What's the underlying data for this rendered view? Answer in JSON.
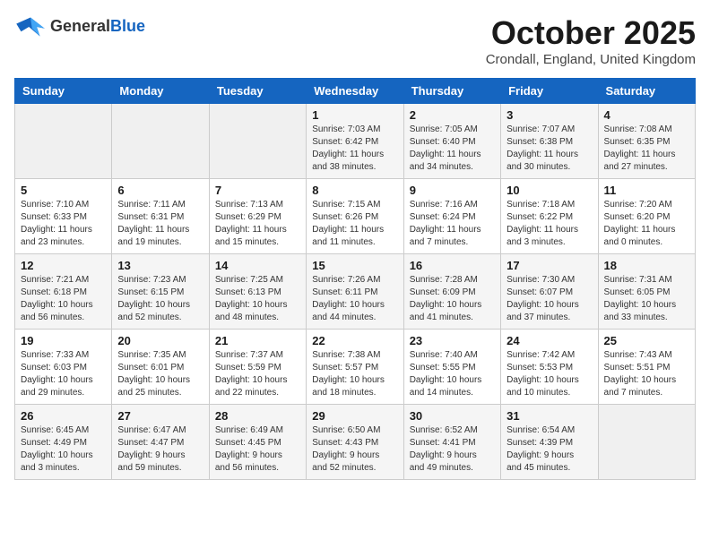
{
  "header": {
    "logo_general": "General",
    "logo_blue": "Blue",
    "month_title": "October 2025",
    "location": "Crondall, England, United Kingdom"
  },
  "weekdays": [
    "Sunday",
    "Monday",
    "Tuesday",
    "Wednesday",
    "Thursday",
    "Friday",
    "Saturday"
  ],
  "weeks": [
    [
      {
        "day": "",
        "info": ""
      },
      {
        "day": "",
        "info": ""
      },
      {
        "day": "",
        "info": ""
      },
      {
        "day": "1",
        "info": "Sunrise: 7:03 AM\nSunset: 6:42 PM\nDaylight: 11 hours\nand 38 minutes."
      },
      {
        "day": "2",
        "info": "Sunrise: 7:05 AM\nSunset: 6:40 PM\nDaylight: 11 hours\nand 34 minutes."
      },
      {
        "day": "3",
        "info": "Sunrise: 7:07 AM\nSunset: 6:38 PM\nDaylight: 11 hours\nand 30 minutes."
      },
      {
        "day": "4",
        "info": "Sunrise: 7:08 AM\nSunset: 6:35 PM\nDaylight: 11 hours\nand 27 minutes."
      }
    ],
    [
      {
        "day": "5",
        "info": "Sunrise: 7:10 AM\nSunset: 6:33 PM\nDaylight: 11 hours\nand 23 minutes."
      },
      {
        "day": "6",
        "info": "Sunrise: 7:11 AM\nSunset: 6:31 PM\nDaylight: 11 hours\nand 19 minutes."
      },
      {
        "day": "7",
        "info": "Sunrise: 7:13 AM\nSunset: 6:29 PM\nDaylight: 11 hours\nand 15 minutes."
      },
      {
        "day": "8",
        "info": "Sunrise: 7:15 AM\nSunset: 6:26 PM\nDaylight: 11 hours\nand 11 minutes."
      },
      {
        "day": "9",
        "info": "Sunrise: 7:16 AM\nSunset: 6:24 PM\nDaylight: 11 hours\nand 7 minutes."
      },
      {
        "day": "10",
        "info": "Sunrise: 7:18 AM\nSunset: 6:22 PM\nDaylight: 11 hours\nand 3 minutes."
      },
      {
        "day": "11",
        "info": "Sunrise: 7:20 AM\nSunset: 6:20 PM\nDaylight: 11 hours\nand 0 minutes."
      }
    ],
    [
      {
        "day": "12",
        "info": "Sunrise: 7:21 AM\nSunset: 6:18 PM\nDaylight: 10 hours\nand 56 minutes."
      },
      {
        "day": "13",
        "info": "Sunrise: 7:23 AM\nSunset: 6:15 PM\nDaylight: 10 hours\nand 52 minutes."
      },
      {
        "day": "14",
        "info": "Sunrise: 7:25 AM\nSunset: 6:13 PM\nDaylight: 10 hours\nand 48 minutes."
      },
      {
        "day": "15",
        "info": "Sunrise: 7:26 AM\nSunset: 6:11 PM\nDaylight: 10 hours\nand 44 minutes."
      },
      {
        "day": "16",
        "info": "Sunrise: 7:28 AM\nSunset: 6:09 PM\nDaylight: 10 hours\nand 41 minutes."
      },
      {
        "day": "17",
        "info": "Sunrise: 7:30 AM\nSunset: 6:07 PM\nDaylight: 10 hours\nand 37 minutes."
      },
      {
        "day": "18",
        "info": "Sunrise: 7:31 AM\nSunset: 6:05 PM\nDaylight: 10 hours\nand 33 minutes."
      }
    ],
    [
      {
        "day": "19",
        "info": "Sunrise: 7:33 AM\nSunset: 6:03 PM\nDaylight: 10 hours\nand 29 minutes."
      },
      {
        "day": "20",
        "info": "Sunrise: 7:35 AM\nSunset: 6:01 PM\nDaylight: 10 hours\nand 25 minutes."
      },
      {
        "day": "21",
        "info": "Sunrise: 7:37 AM\nSunset: 5:59 PM\nDaylight: 10 hours\nand 22 minutes."
      },
      {
        "day": "22",
        "info": "Sunrise: 7:38 AM\nSunset: 5:57 PM\nDaylight: 10 hours\nand 18 minutes."
      },
      {
        "day": "23",
        "info": "Sunrise: 7:40 AM\nSunset: 5:55 PM\nDaylight: 10 hours\nand 14 minutes."
      },
      {
        "day": "24",
        "info": "Sunrise: 7:42 AM\nSunset: 5:53 PM\nDaylight: 10 hours\nand 10 minutes."
      },
      {
        "day": "25",
        "info": "Sunrise: 7:43 AM\nSunset: 5:51 PM\nDaylight: 10 hours\nand 7 minutes."
      }
    ],
    [
      {
        "day": "26",
        "info": "Sunrise: 6:45 AM\nSunset: 4:49 PM\nDaylight: 10 hours\nand 3 minutes."
      },
      {
        "day": "27",
        "info": "Sunrise: 6:47 AM\nSunset: 4:47 PM\nDaylight: 9 hours\nand 59 minutes."
      },
      {
        "day": "28",
        "info": "Sunrise: 6:49 AM\nSunset: 4:45 PM\nDaylight: 9 hours\nand 56 minutes."
      },
      {
        "day": "29",
        "info": "Sunrise: 6:50 AM\nSunset: 4:43 PM\nDaylight: 9 hours\nand 52 minutes."
      },
      {
        "day": "30",
        "info": "Sunrise: 6:52 AM\nSunset: 4:41 PM\nDaylight: 9 hours\nand 49 minutes."
      },
      {
        "day": "31",
        "info": "Sunrise: 6:54 AM\nSunset: 4:39 PM\nDaylight: 9 hours\nand 45 minutes."
      },
      {
        "day": "",
        "info": ""
      }
    ]
  ]
}
